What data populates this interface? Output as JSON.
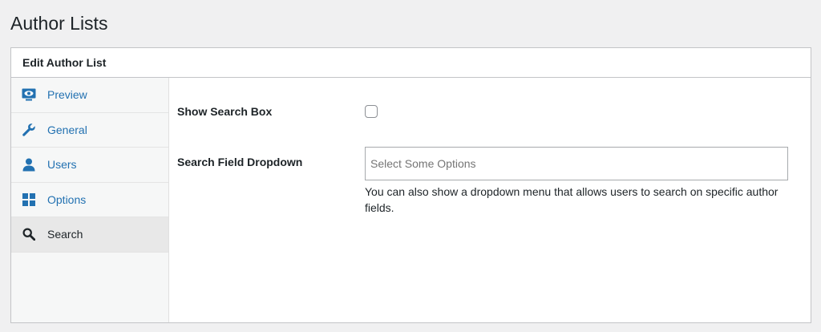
{
  "page": {
    "title": "Author Lists"
  },
  "panel": {
    "header": "Edit Author List"
  },
  "sidebar": {
    "items": [
      {
        "label": "Preview",
        "icon": "monitor-eye-icon",
        "active": false
      },
      {
        "label": "General",
        "icon": "wrench-icon",
        "active": false
      },
      {
        "label": "Users",
        "icon": "user-icon",
        "active": false
      },
      {
        "label": "Options",
        "icon": "grid-icon",
        "active": false
      },
      {
        "label": "Search",
        "icon": "search-icon",
        "active": true
      }
    ]
  },
  "fields": {
    "show_search_box": {
      "label": "Show Search Box",
      "checked": false
    },
    "search_field_dropdown": {
      "label": "Search Field Dropdown",
      "placeholder": "Select Some Options",
      "description": "You can also show a dropdown menu that allows users to search on specific author fields."
    }
  },
  "colors": {
    "accent": "#2271b1",
    "text": "#1d2327",
    "border": "#c3c4c7"
  }
}
